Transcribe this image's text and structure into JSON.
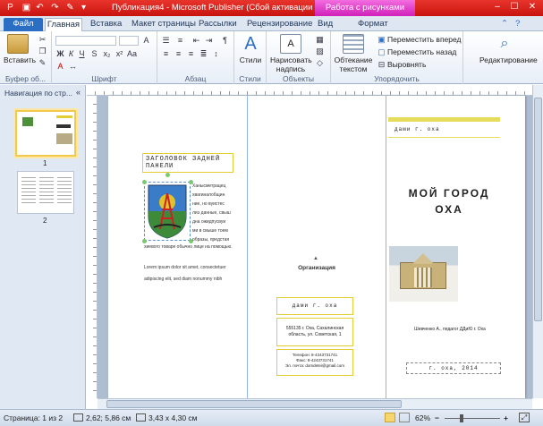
{
  "window": {
    "title": "Публикация4 - Microsoft Publisher (Сбой активации продукта)",
    "context_tab": "Работа с рисунками",
    "accent": "#d21a12"
  },
  "tabs": {
    "file": "Файл",
    "home": "Главная",
    "insert": "Вставка",
    "page_layout": "Макет страницы",
    "mailings": "Рассылки",
    "review": "Рецензирование",
    "view": "Вид",
    "format": "Формат"
  },
  "ribbon": {
    "clipboard": {
      "paste": "Вставить",
      "label": "Буфер об..."
    },
    "font": {
      "label": "Шрифт"
    },
    "paragraph": {
      "label": "Абзац"
    },
    "styles": {
      "styles": "Стили",
      "label": "Стили"
    },
    "objects": {
      "draw_textbox": "Нарисовать надпись",
      "label": "Объекты"
    },
    "arrange": {
      "wrap_text": "Обтекание текстом",
      "bring_forward": "Переместить вперед",
      "send_backward": "Переместить назад",
      "align": "Выровнять",
      "label": "Упорядочить"
    },
    "editing": {
      "label": "Редактирование"
    }
  },
  "nav": {
    "title": "Навигация по стр...",
    "page1": "1",
    "page2": "2"
  },
  "page": {
    "heading": "ЗАГОЛОВОК ЗАДНЕЙ ПАНЕЛИ",
    "body_lines": [
      "Ханысметрацец",
      "хвагиналобщин",
      "ние, но вуистес",
      "лиэ данные, свыш",
      "дна ожидпусвуи",
      "ми в свыше тоем",
      "образы, предстая",
      "хиевого товаре обычно лице на помощью."
    ],
    "body2_lines": [
      "Lorem ipsum dolor sit amet, consectetuer",
      "adipiscing elit, sed diam nonummy nibh"
    ],
    "org": "Организация",
    "contact_title": "дами г. оха",
    "contact_address": "555135 г. Оха, Сахалинская область, ул. Советская, 1",
    "contact_phones": "Телефон: 8-4243731741\nФакс: 8-4243731741\nЭл. почта: domdetei@gmail.com",
    "cover_header": "дами г. оха",
    "cover_title": "МОЙ ГОРОД ОХА",
    "cover_author": "Шевченко А., педагог ДДиЮ г. Оха",
    "cover_footer": "г. оха, 2014"
  },
  "status": {
    "page": "Страница: 1 из 2",
    "position": "2,62; 5,86 см",
    "size": "3,43 x 4,30 см",
    "zoom": "62%",
    "zoom_level": 0.62
  }
}
